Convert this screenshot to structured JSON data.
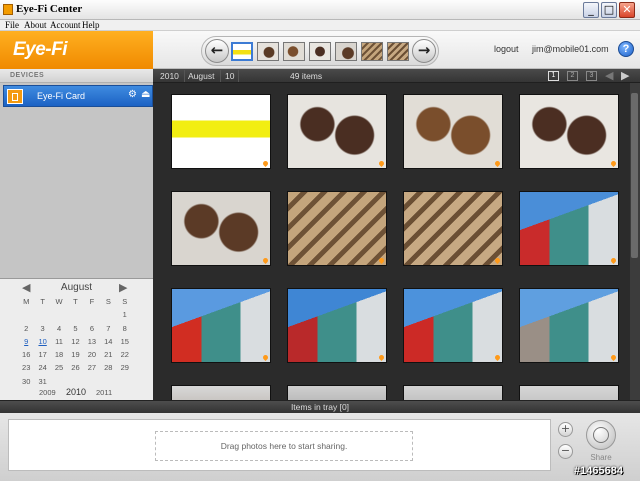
{
  "window": {
    "title": "Eye-Fi Center",
    "min_label": "_",
    "max_label": "□",
    "close_label": "✕"
  },
  "menu": [
    "File",
    "About",
    "Account",
    "Help"
  ],
  "header": {
    "logo": "Eye-Fi",
    "logout": "logout",
    "account": "jim@mobile01.com",
    "help": "?",
    "prev": "←",
    "next": "→"
  },
  "sidebar": {
    "section": "DEVICES",
    "device": "Eye-Fi Card",
    "device_icons": [
      "gear-icon",
      "eject-icon"
    ]
  },
  "calendar": {
    "month": "August",
    "prev": "◀",
    "next": "▶",
    "weekdays": [
      "M",
      "T",
      "W",
      "T",
      "F",
      "S",
      "S"
    ],
    "days": [
      "",
      "",
      "",
      "",
      "",
      "",
      "1",
      "2",
      "3",
      "4",
      "5",
      "6",
      "7",
      "8",
      "9",
      "10",
      "11",
      "12",
      "13",
      "14",
      "15",
      "16",
      "17",
      "18",
      "19",
      "20",
      "21",
      "22",
      "23",
      "24",
      "25",
      "26",
      "27",
      "28",
      "29",
      "30",
      "31",
      "",
      "",
      "",
      "",
      ""
    ],
    "linked_days": [
      "9",
      "10"
    ],
    "years": [
      "2009",
      "2010",
      "2011"
    ]
  },
  "main": {
    "path": [
      "2010",
      "August",
      "10"
    ],
    "count": "49 items",
    "pages": [
      "1",
      "2",
      "3"
    ],
    "page_prev": "◀",
    "page_next": "▶"
  },
  "photos": [
    {
      "kind": "hand",
      "colors": [
        "#ffffff",
        "#f2ee12"
      ]
    },
    {
      "kind": "cookies",
      "colors": [
        "#e7e4df",
        "#4a2e22"
      ]
    },
    {
      "kind": "cookies",
      "colors": [
        "#e1ddd6",
        "#7a4e2c"
      ]
    },
    {
      "kind": "cookies",
      "colors": [
        "#e9e6e1",
        "#4b2e22"
      ]
    },
    {
      "kind": "cookies",
      "colors": [
        "#d9d5cf",
        "#5b3a26"
      ]
    },
    {
      "kind": "box",
      "colors": [
        "#c4a57c",
        "#6e5236"
      ]
    },
    {
      "kind": "box",
      "colors": [
        "#c7a983",
        "#6b4f34"
      ]
    },
    {
      "kind": "building",
      "colors": [
        "#4a8ed8",
        "#c92b2b"
      ]
    },
    {
      "kind": "building",
      "colors": [
        "#5a9ae0",
        "#d12d22"
      ]
    },
    {
      "kind": "building",
      "colors": [
        "#3f86d4",
        "#b9292a"
      ]
    },
    {
      "kind": "building",
      "colors": [
        "#4c92dc",
        "#cc2a26"
      ]
    },
    {
      "kind": "building",
      "colors": [
        "#5f9fe0",
        "#9a8f86"
      ]
    },
    {
      "kind": "partial",
      "colors": [
        "#d8d8d8",
        "#8a7a6a"
      ]
    },
    {
      "kind": "partial",
      "colors": [
        "#cfcfcf",
        "#6f6f6f"
      ]
    },
    {
      "kind": "partial",
      "colors": [
        "#d4d4d4",
        "#7c7c7c"
      ]
    },
    {
      "kind": "partial",
      "colors": [
        "#d6d6d6",
        "#8c8c8c"
      ]
    }
  ],
  "tray": {
    "title": "Items in tray [0]",
    "drop": "Drag photos here to start sharing.",
    "add": "+",
    "remove": "−",
    "share": "Share"
  },
  "watermark": "#1465684"
}
